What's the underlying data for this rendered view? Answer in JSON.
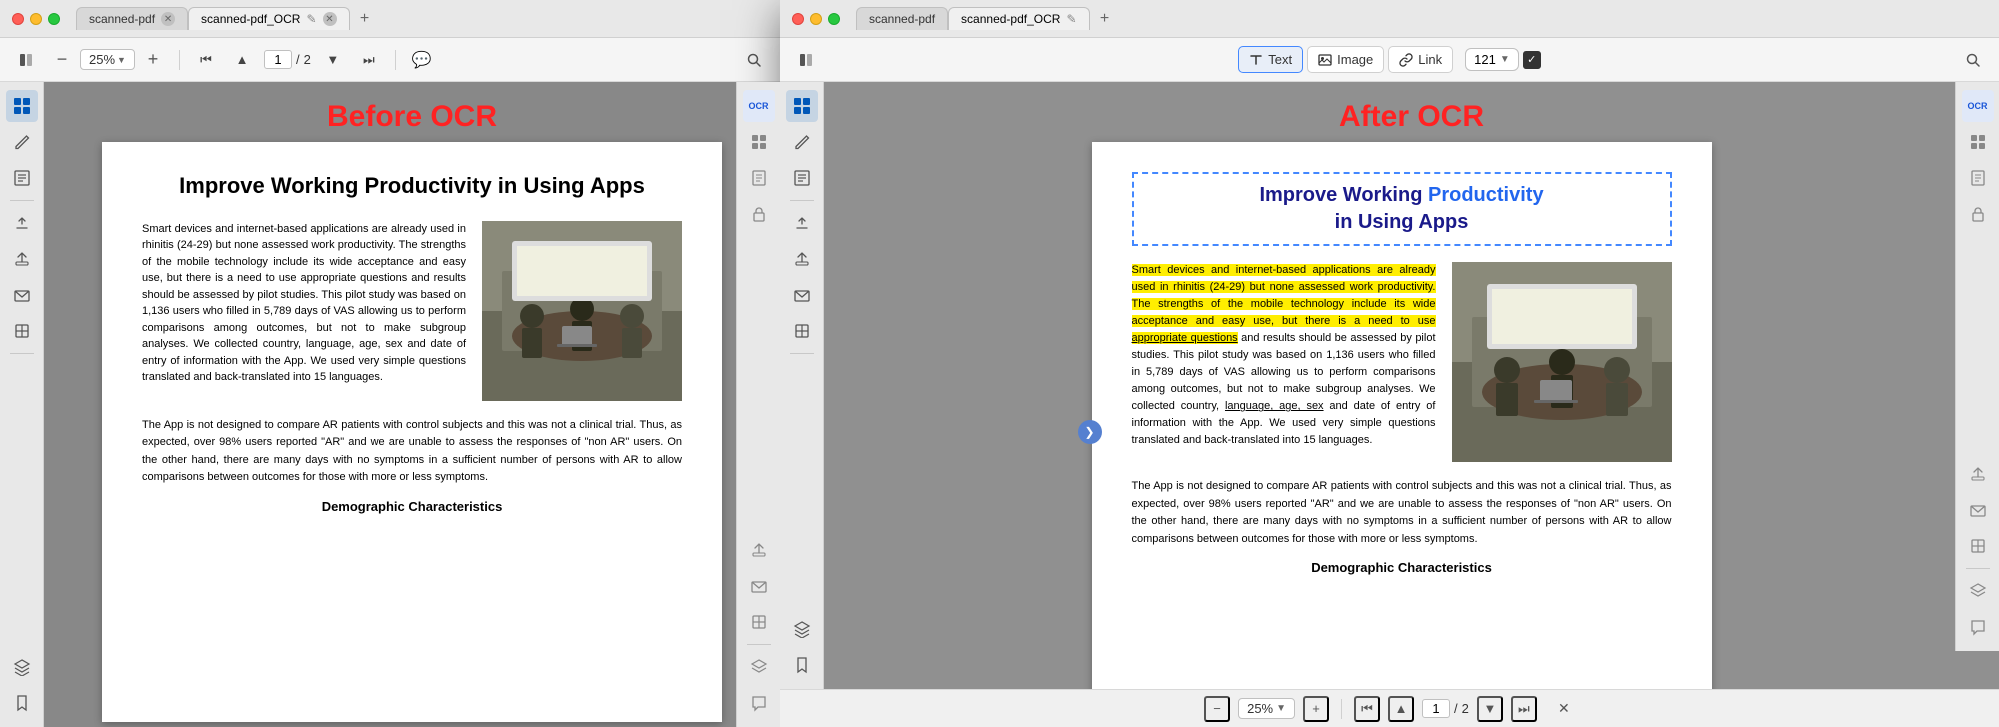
{
  "left_window": {
    "title": "scanned-pdf",
    "tabs": [
      {
        "label": "scanned-pdf",
        "active": false
      },
      {
        "label": "scanned-pdf_OCR",
        "active": true
      }
    ],
    "toolbar": {
      "zoom": "25%",
      "page_current": "1",
      "page_total": "2"
    },
    "ocr_label": "Before OCR",
    "pdf_title": "Improve Working Productivity in Using Apps",
    "paragraph1": "Smart devices and internet-based applications are already used in rhinitis (24-29) but none assessed work productivity. The strengths of the mobile technology include its wide acceptance and easy use, but there is a need to use appropriate questions and results should be assessed by pilot studies. This pilot study was based on 1,136 users who filled in 5,789 days of VAS allowing us to perform comparisons among outcomes, but not to make subgroup analyses. We collected country, language, age, sex and date of entry of information with the App. We used very simple questions translated and back-translated into 15 languages.",
    "paragraph2": "The App is not designed to compare AR patients with control subjects and this was not a clinical trial. Thus, as expected, over 98% users reported \"AR\" and we are unable to assess the responses of \"non AR\" users. On the other hand, there are many days with no symptoms in a sufficient number of persons with AR to allow comparisons between outcomes for those with more or less symptoms.",
    "section_bottom": "Demographic Characteristics"
  },
  "right_window": {
    "title": "scanned-pdf",
    "tab_active": "scanned-pdf_OCR",
    "tabs": [
      {
        "label": "scanned-pdf",
        "active": false
      },
      {
        "label": "scanned-pdf_OCR",
        "active": true
      }
    ],
    "tools": {
      "text_label": "Text",
      "image_label": "Image",
      "link_label": "Link"
    },
    "zoom_value": "121",
    "ocr_label": "After OCR",
    "pdf_title_line1": "Improve Working",
    "pdf_title_line2_pre": "in Using Apps",
    "pdf_title_highlight": "Productivity",
    "paragraph1_highlighted": "Smart devices and internet-based applications are already used in rhinitis (24-29) but none assessed work productivity. The strengths of the mobile technology include its wide acceptance and easy use, but there is a need to use appropriate questions and results should be assessed by pilot studies. This pilot study was based on 1,136 users who filled in 5,789 days of VAS allowing us to perform comparisons among outcomes, but not to make subgroup analyses. We collected country, language, age, sex and date of entry of information with the App. We used very simple questions translated and back-translated into 15 languages.",
    "paragraph2": "The App is not designed to compare AR patients with control subjects and this was not a clinical trial. Thus, as expected, over 98% users reported \"AR\" and we are unable to assess the responses of \"non AR\" users. On the other hand, there are many days with no symptoms in a sufficient number of persons with AR to allow comparisons between outcomes for those with more or less symptoms.",
    "section_bottom": "Demographic Characteristics",
    "bottom_bar": {
      "page_current": "1",
      "page_total": "2",
      "zoom": "25%"
    }
  },
  "sidebar_icons": {
    "thumbnail": "⊞",
    "edit": "✏",
    "list": "≡",
    "divider": "",
    "stamp": "🖊",
    "share": "⬆",
    "mail": "✉",
    "plugin": "⊟",
    "bookmark": "🔖",
    "layers": "◧",
    "star": "☆"
  }
}
